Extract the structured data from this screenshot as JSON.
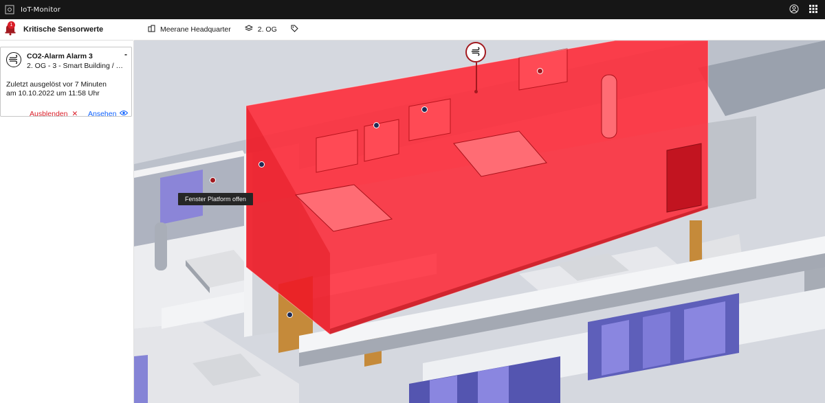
{
  "app": {
    "title": "IoT-Monitor"
  },
  "left_panel": {
    "header_title": "Kritische Sensorwerte",
    "badge_count": "1",
    "alarm": {
      "title": "CO2-Alarm Alarm 3",
      "subtitle": "2. OG - 3 - Smart Building / Fact...",
      "collapse_label": "-",
      "desc_line1": "Zuletzt ausgelöst vor 7 Minuten",
      "desc_line2": "am 10.10.2022 um 11:58 Uhr",
      "hide_label": "Ausblenden",
      "hide_icon": "close-icon",
      "view_label": "Ansehen",
      "view_icon": "eye-icon"
    }
  },
  "breadcrumb": {
    "building": "Meerane Headquarter",
    "building_icon": "building-icon",
    "floor": "2. OG",
    "floor_icon": "layers-icon",
    "tag_icon": "tag-icon"
  },
  "viewport": {
    "tooltip": "Fenster Platform offen",
    "marker_icon": "air-flow-icon"
  },
  "colors": {
    "alarm_red": "#da1e28",
    "link_blue": "#0f62fe",
    "topbar_bg": "#161616",
    "highlight_zone": "#ff1f2d"
  }
}
